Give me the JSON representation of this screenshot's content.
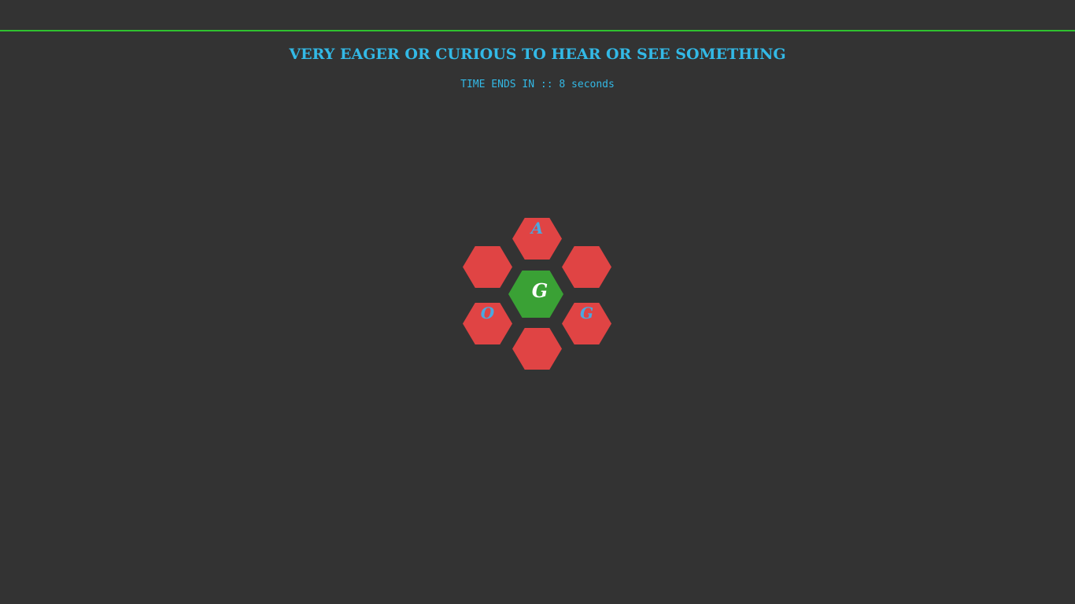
{
  "game": {
    "clue": "VERY EAGER OR CURIOUS TO HEAR OR SEE SOMETHING",
    "timer_label": "TIME ENDS IN :: 8 seconds"
  },
  "hexes": {
    "center": {
      "letter": "G",
      "color": "#3aa135"
    },
    "top": {
      "letter": "A",
      "color": "#e04444"
    },
    "upper_left": {
      "letter": "",
      "color": "#e04444"
    },
    "upper_right": {
      "letter": "",
      "color": "#e04444"
    },
    "lower_left": {
      "letter": "O",
      "color": "#e04444"
    },
    "lower_right": {
      "letter": "G",
      "color": "#e04444"
    },
    "bottom": {
      "letter": "",
      "color": "#e04444"
    }
  },
  "colors": {
    "background": "#333333",
    "accent_line": "#2fc12f",
    "text": "#33b9e6"
  }
}
